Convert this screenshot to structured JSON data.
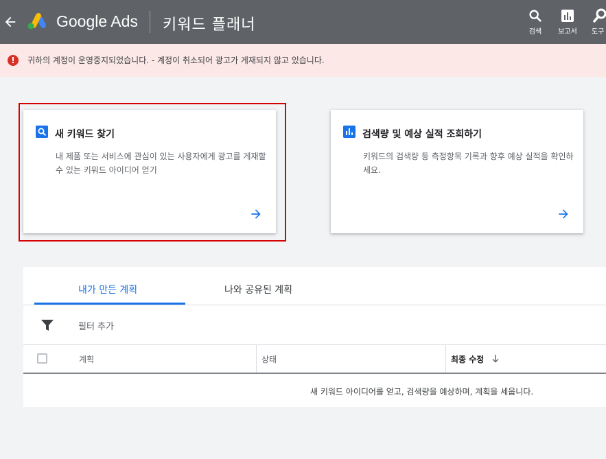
{
  "header": {
    "brand": "Google Ads",
    "title": "키워드 플래너",
    "tools": [
      {
        "label": "검색",
        "icon": "search-icon"
      },
      {
        "label": "보고서",
        "icon": "bar-chart-icon"
      },
      {
        "label": "도구",
        "icon": "wrench-icon"
      }
    ]
  },
  "alert": {
    "icon": "!",
    "text": "귀하의 계정이 운영중지되었습니다. - 계정이 취소되어 광고가 게재되지 않고 있습니다."
  },
  "cards": [
    {
      "title": "새 키워드 찾기",
      "description": "내 제품 또는 서비스에 관심이 있는 사용자에게 광고를 게재할 수 있는 키워드 아이디어 얻기",
      "icon": "search-icon"
    },
    {
      "title": "검색량 및 예상 실적 조회하기",
      "description": "키워드의 검색량 등 측정항목 기록과 향후 예상 실적을 확인하세요.",
      "icon": "bar-chart-icon"
    }
  ],
  "plans": {
    "tabs": [
      "내가 만든 계획",
      "나와 공유된 계획"
    ],
    "filter_label": "필터 추가",
    "columns": [
      "계획",
      "상태",
      "최종 수정"
    ],
    "empty_message": "새 키워드 아이디어를 얻고, 검색량을 예상하며, 계획을 세웁니다."
  },
  "colors": {
    "header_bg": "#5f6368",
    "accent": "#1a73e8",
    "alert_bg": "#fce8e6",
    "error": "#d93025",
    "highlight_border": "#d50000"
  }
}
